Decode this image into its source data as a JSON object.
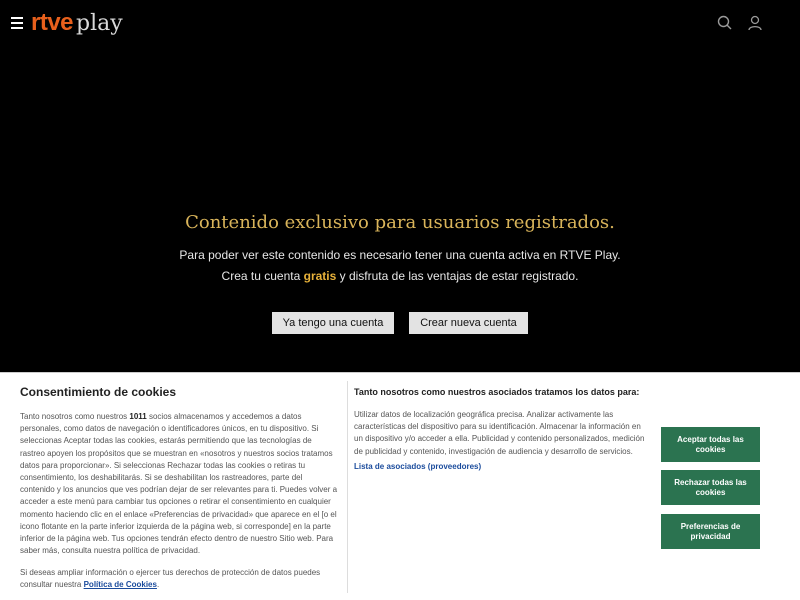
{
  "header": {
    "logo_brand": "rtve",
    "logo_product": "play"
  },
  "main": {
    "title": "Contenido exclusivo para usuarios registrados.",
    "line1": "Para poder ver este contenido es necesario tener una cuenta activa en RTVE Play.",
    "line2_before": "Crea tu cuenta ",
    "line2_highlight": "gratis",
    "line2_after": " y disfruta de las ventajas de estar registrado.",
    "login_button": "Ya tengo una cuenta",
    "create_button": "Crear nueva cuenta"
  },
  "cookies": {
    "title": "Consentimiento de cookies",
    "text_before_count": "Tanto nosotros como nuestros ",
    "partner_count": "1011",
    "text_after_count": " socios almacenamos y accedemos a datos personales, como datos de navegación o identificadores únicos, en tu dispositivo. Si seleccionas Aceptar todas las cookies, estarás permitiendo que las tecnologías de rastreo apoyen los propósitos que se muestran en «nosotros y nuestros socios tratamos datos para proporcionar». Si seleccionas Rechazar todas las cookies o retiras tu consentimiento, los deshabilitarás. Si se deshabilitan los rastreadores, parte del contenido y los anuncios que ves podrían dejar de ser relevantes para ti. Puedes volver a acceder a este menú para cambiar tus opciones o retirar el consentimiento en cualquier momento haciendo clic en el enlace «Preferencias de privacidad» que aparece en el [o el icono flotante en la parte inferior izquierda de la página web, si corresponde] en la parte inferior de la página web. Tus opciones tendrán efecto dentro de nuestro Sitio web. Para saber más, consulta nuestra política de privacidad.",
    "rights_text": "Si deseas ampliar información o ejercer tus derechos de protección de datos puedes consultar nuestra ",
    "policy_link": "Política de Cookies",
    "rights_end": ".",
    "purposes_title": "Tanto nosotros como nuestros asociados tratamos los datos para:",
    "purposes_text": "Utilizar datos de localización geográfica precisa. Analizar activamente las características del dispositivo para su identificación. Almacenar la información en un dispositivo y/o acceder a ella. Publicidad y contenido personalizados, medición de publicidad y contenido, investigación de audiencia y desarrollo de servicios.",
    "partners_link": "Lista de asociados (proveedores)",
    "accept_button": "Aceptar todas las cookies",
    "reject_button": "Rechazar todas las cookies",
    "prefs_button": "Preferencias de privacidad"
  },
  "icons": {
    "menu": "hamburger-menu-icon",
    "search": "search-icon",
    "user": "user-icon"
  },
  "colors": {
    "brand_orange": "#e8601c",
    "title_gold": "#d9b45a",
    "cookie_button_green": "#2b7350",
    "link_blue": "#1a4b9c"
  }
}
